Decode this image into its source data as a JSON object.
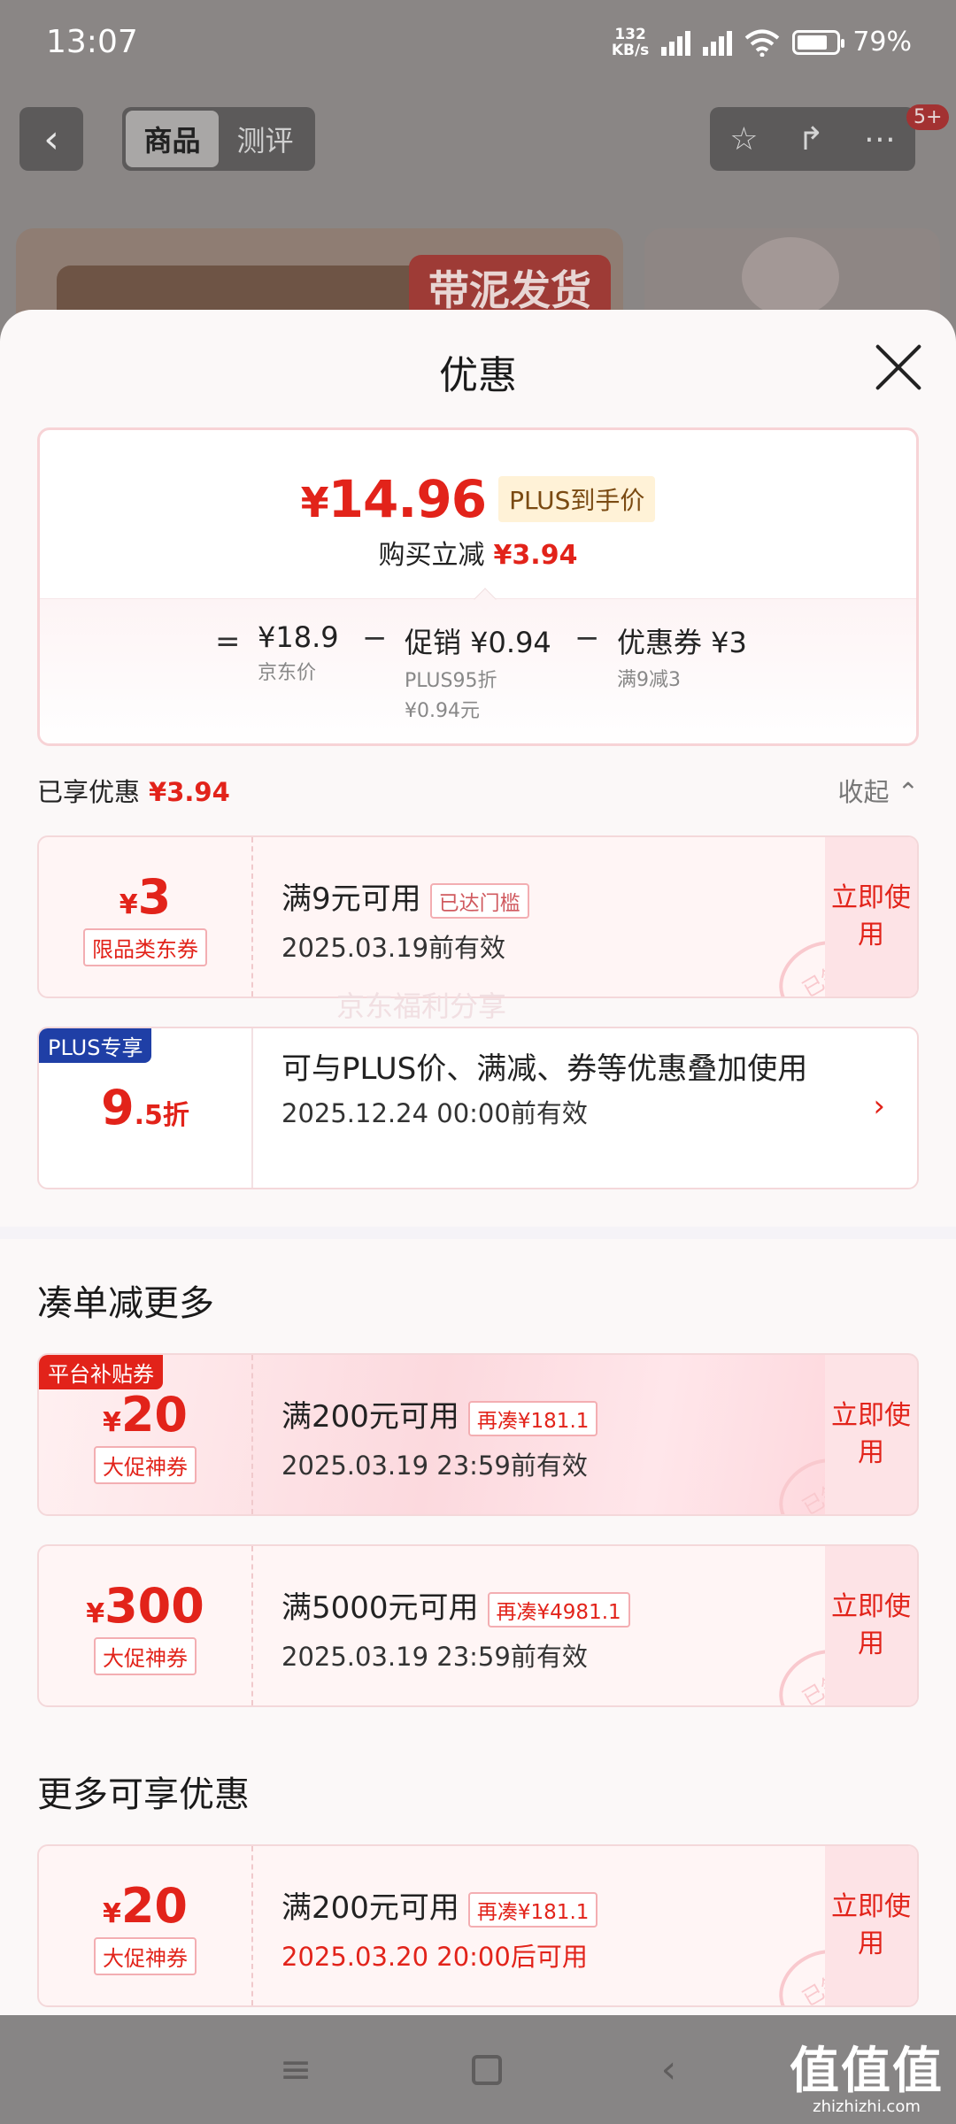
{
  "status": {
    "time": "13:07",
    "net_speed": "132",
    "net_unit": "KB/s",
    "battery": "79%",
    "battery_level": 0.79
  },
  "header": {
    "tabs": [
      "商品",
      "测评"
    ],
    "badge": "5+",
    "image_tag": "带泥发货"
  },
  "sheet": {
    "title": "优惠",
    "price": {
      "final_price": "14.96",
      "currency": "¥",
      "plus_label": "PLUS到手价",
      "reduce_label": "购买立减",
      "reduce_amount": "¥3.94",
      "formula": {
        "eq": "=",
        "minus": "−",
        "jd_price": "¥18.9",
        "jd_price_label": "京东价",
        "promo": "促销 ¥0.94",
        "promo_sub1": "PLUS95折",
        "promo_sub2": "¥0.94元",
        "coupon": "优惠券 ¥3",
        "coupon_sub": "满9减3"
      }
    },
    "enjoyed": {
      "label": "已享优惠",
      "amount": "¥3.94",
      "collapse": "收起"
    },
    "coupon1": {
      "cur": "¥",
      "amount": "3",
      "type": "限品类东券",
      "condition": "满9元可用",
      "tag": "已达门槛",
      "valid": "2025.03.19前有效",
      "action": "立即使用",
      "stamp": "已领"
    },
    "plus": {
      "corner": "PLUS专享",
      "disc_int": "9",
      "disc_dec": ".5折",
      "desc": "可与PLUS价、满减、券等优惠叠加使用",
      "valid": "2025.12.24 00:00前有效"
    },
    "watermark": "京东福利分享",
    "section1": "凑单减更多",
    "coupon2": {
      "corner": "平台补贴券",
      "cur": "¥",
      "amount": "20",
      "type": "大促神券",
      "condition": "满200元可用",
      "tag": "再凑¥181.1",
      "valid": "2025.03.19 23:59前有效",
      "action": "立即使用",
      "stamp": "已领"
    },
    "coupon3": {
      "cur": "¥",
      "amount": "300",
      "type": "大促神券",
      "condition": "满5000元可用",
      "tag": "再凑¥4981.1",
      "valid": "2025.03.19 23:59前有效",
      "action": "立即使用",
      "stamp": "已领"
    },
    "section2": "更多可享优惠",
    "coupon4": {
      "cur": "¥",
      "amount": "20",
      "type": "大促神券",
      "condition": "满200元可用",
      "tag": "再凑¥181.1",
      "valid": "2025.03.20 20:00后可用",
      "action": "立即使用",
      "stamp": "已领"
    }
  },
  "brand": {
    "cn": "值值值",
    "en": "zhizhizhi.com"
  },
  "colors": {
    "accent": "#e2231a",
    "plus_blue": "#1f3fa6"
  }
}
